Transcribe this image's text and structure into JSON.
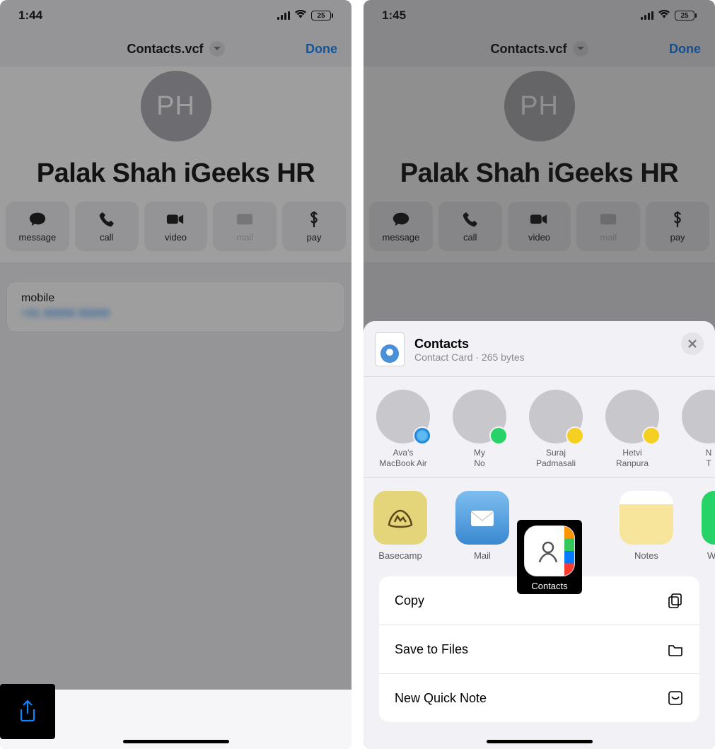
{
  "left": {
    "status": {
      "time": "1:44",
      "battery": "25"
    },
    "nav": {
      "title": "Contacts.vcf",
      "done": "Done"
    },
    "contact": {
      "initials": "PH",
      "name": "Palak Shah iGeeks HR",
      "actions": {
        "message": "message",
        "call": "call",
        "video": "video",
        "mail": "mail",
        "pay": "pay"
      },
      "field": {
        "label": "mobile",
        "value": "+91 99999 99999"
      }
    }
  },
  "right": {
    "status": {
      "time": "1:45",
      "battery": "25"
    },
    "nav": {
      "title": "Contacts.vcf",
      "done": "Done"
    },
    "contact": {
      "initials": "PH",
      "name": "Palak Shah iGeeks HR",
      "actions": {
        "message": "message",
        "call": "call",
        "video": "video",
        "mail": "mail",
        "pay": "pay"
      }
    },
    "sheet": {
      "title": "Contacts",
      "subtitle": "Contact Card · 265 bytes",
      "people": [
        {
          "name_line1": "Ava's",
          "name_line2": "MacBook Air",
          "badge": "airdrop"
        },
        {
          "name_line1": "My",
          "name_line2": "No",
          "badge": "whatsapp"
        },
        {
          "name_line1": "Suraj",
          "name_line2": "Padmasali",
          "badge": "bc"
        },
        {
          "name_line1": "Hetvi",
          "name_line2": "Ranpura",
          "badge": "bc"
        },
        {
          "name_line1": "N",
          "name_line2": "T",
          "badge": "bc"
        }
      ],
      "apps": [
        {
          "name": "Basecamp",
          "kind": "basecamp"
        },
        {
          "name": "Mail",
          "kind": "mail"
        },
        {
          "name": "Contacts",
          "kind": "contacts"
        },
        {
          "name": "Notes",
          "kind": "notes"
        },
        {
          "name": "WhatsApp",
          "kind": "wa"
        }
      ],
      "actions": {
        "copy": "Copy",
        "save": "Save to Files",
        "quicknote": "New Quick Note"
      }
    }
  }
}
